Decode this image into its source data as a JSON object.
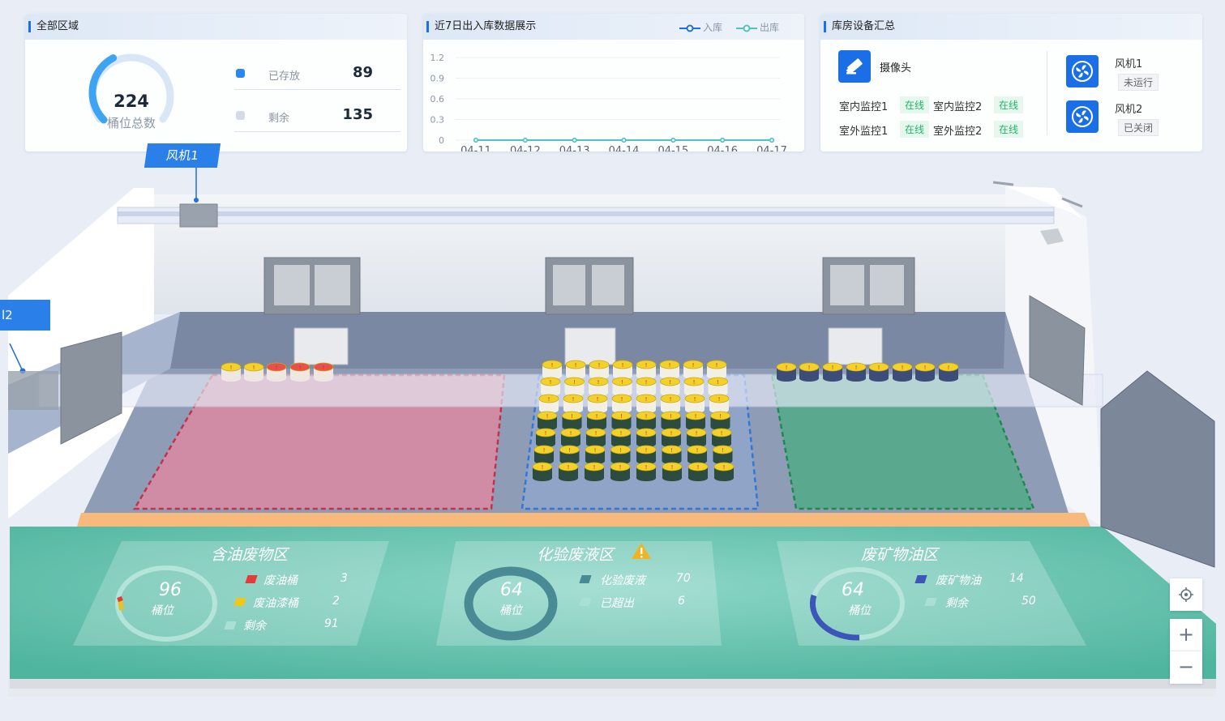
{
  "all_area": {
    "title": "全部区域",
    "total": "224",
    "total_label": "桶位总数",
    "stored_label": "已存放",
    "stored_value": "89",
    "remaining_label": "剩余",
    "remaining_value": "135",
    "stored_fraction": 0.397,
    "colors": {
      "stored": "#2a86f0",
      "remaining": "#d5dbe4"
    }
  },
  "io_chart": {
    "panel_title": "近7日出入库数据展示",
    "legend_in": "入库",
    "legend_out": "出库"
  },
  "chart_data": {
    "type": "line",
    "x": [
      "04-11",
      "04-12",
      "04-13",
      "04-14",
      "04-15",
      "04-16",
      "04-17"
    ],
    "ylim": [
      0,
      1.2
    ],
    "yticks": [
      "1.2",
      "0.9",
      "0.6",
      "0.3",
      "0"
    ],
    "series": [
      {
        "name": "入库",
        "values": [
          0,
          0,
          0,
          0,
          0,
          0,
          0
        ],
        "color": "#1f6fe0"
      },
      {
        "name": "出库",
        "values": [
          0,
          0,
          0,
          0,
          0,
          0,
          0
        ],
        "color": "#4fc3c0"
      }
    ],
    "grid": true,
    "legend_position": "top-right"
  },
  "devices": {
    "title": "库房设备汇总",
    "camera_label": "摄像头",
    "monitors": [
      {
        "name": "室内监控1",
        "status": "在线"
      },
      {
        "name": "室内监控2",
        "status": "在线"
      },
      {
        "name": "室外监控1",
        "status": "在线"
      },
      {
        "name": "室外监控2",
        "status": "在线"
      }
    ],
    "fans": [
      {
        "name": "风机1",
        "status": "未运行"
      },
      {
        "name": "风机2",
        "status": "已关闭"
      }
    ]
  },
  "scene": {
    "fan1_tag": "风机1",
    "fan2_tag_partial": "l2",
    "zones": [
      {
        "title": "含油废物区",
        "total": "96",
        "unit": "桶位",
        "items": [
          {
            "label": "废油桶",
            "value": "3",
            "color": "#e53a3a"
          },
          {
            "label": "废油漆桶",
            "value": "2",
            "color": "#f2c618"
          },
          {
            "label": "剩余",
            "value": "91",
            "color": "#a8e0d3"
          }
        ]
      },
      {
        "title": "化验废液区",
        "total": "64",
        "unit": "桶位",
        "warning_icon": "warning-icon",
        "items": [
          {
            "label": "化验废液",
            "value": "70",
            "color": "#4a8a95"
          },
          {
            "label": "已超出",
            "value": "6",
            "color": "#a8e0d3"
          }
        ]
      },
      {
        "title": "废矿物油区",
        "total": "64",
        "unit": "桶位",
        "items": [
          {
            "label": "废矿物油",
            "value": "14",
            "color": "#3b56b8"
          },
          {
            "label": "剩余",
            "value": "50",
            "color": "#a8e0d3"
          }
        ]
      }
    ],
    "controls": {
      "zoom_in": "+",
      "zoom_out": "−"
    }
  }
}
